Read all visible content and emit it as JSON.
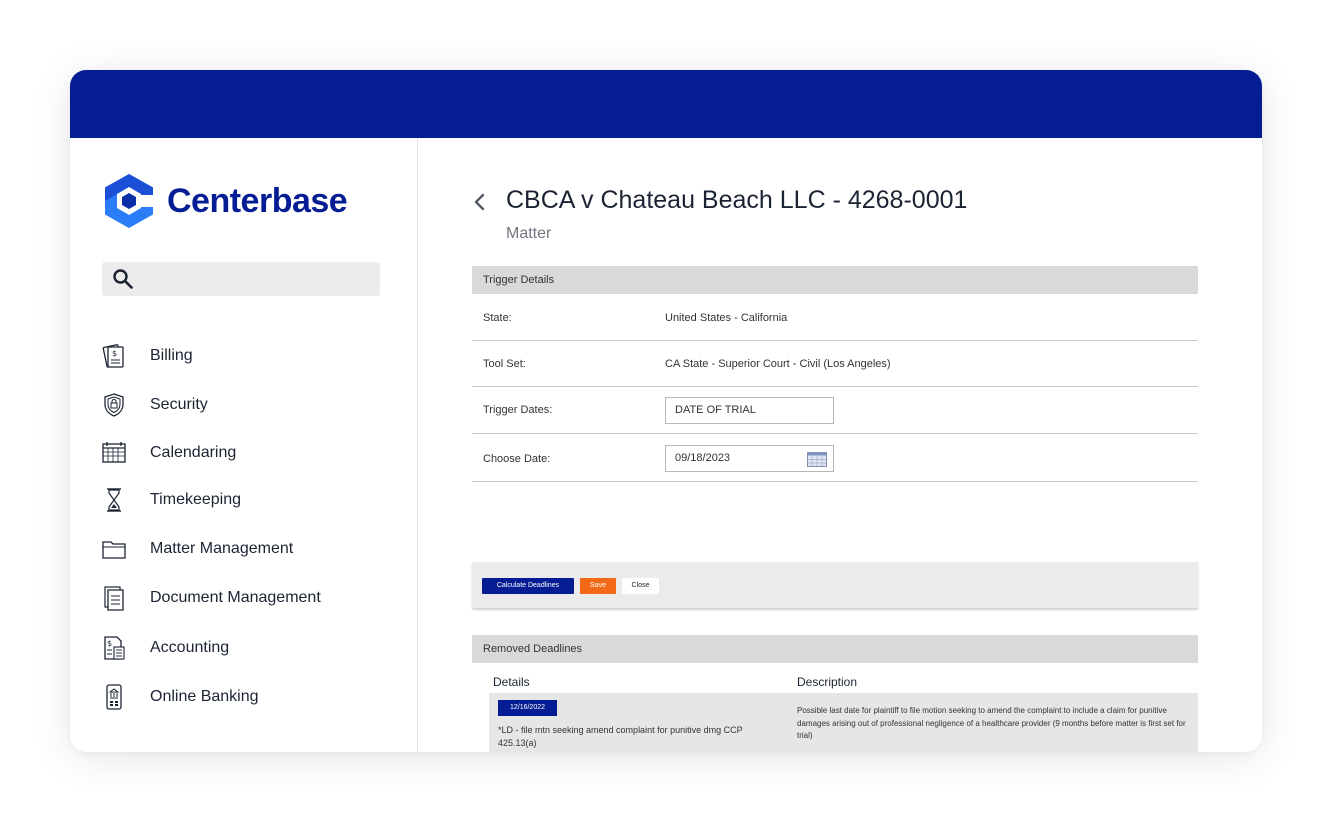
{
  "colors": {
    "brand": "#051d94",
    "save": "#f26a18",
    "section": "#d9d9d9"
  },
  "brand": {
    "name": "Centerbase",
    "logo_icon": "centerbase-logo-icon"
  },
  "search": {
    "icon": "search-icon",
    "placeholder": ""
  },
  "sidebar": {
    "items": [
      {
        "label": "Billing",
        "icon": "billing-icon"
      },
      {
        "label": "Security",
        "icon": "security-icon"
      },
      {
        "label": "Calendaring",
        "icon": "calendar-icon"
      },
      {
        "label": "Timekeeping",
        "icon": "hourglass-icon"
      },
      {
        "label": "Matter Management",
        "icon": "folder-icon"
      },
      {
        "label": "Document Management",
        "icon": "document-icon"
      },
      {
        "label": "Accounting",
        "icon": "accounting-icon"
      },
      {
        "label": "Online Banking",
        "icon": "bank-icon"
      }
    ]
  },
  "header": {
    "back_icon": "chevron-left-icon",
    "title": "CBCA v Chateau Beach LLC - 4268-0001",
    "subtitle": "Matter"
  },
  "trigger": {
    "section_title": "Trigger Details",
    "state_label": "State:",
    "state_value": "United States - California",
    "toolset_label": "Tool Set:",
    "toolset_value": "CA State - Superior Court - Civil (Los Angeles)",
    "dates_label": "Trigger Dates:",
    "dates_value": "DATE OF TRIAL",
    "choose_label": "Choose Date:",
    "choose_value": "09/18/2023",
    "calendar_icon": "calendar-picker-icon"
  },
  "actions": {
    "calculate": "Calculate Deadlines",
    "save": "Save",
    "close": "Close"
  },
  "removed": {
    "section_title": "Removed Deadlines",
    "col_details": "Details",
    "col_description": "Description",
    "rows": [
      {
        "date": "12/16/2022",
        "details": "*LD - file mtn seeking amend complaint for punitive dmg CCP 425.13(a)",
        "description": "Possible last date for plaintiff to file motion seeking to amend the complaint to include a claim for punitive damages arising out of professional negligence of a healthcare provider (9 months before matter is first set for trial)"
      }
    ]
  }
}
